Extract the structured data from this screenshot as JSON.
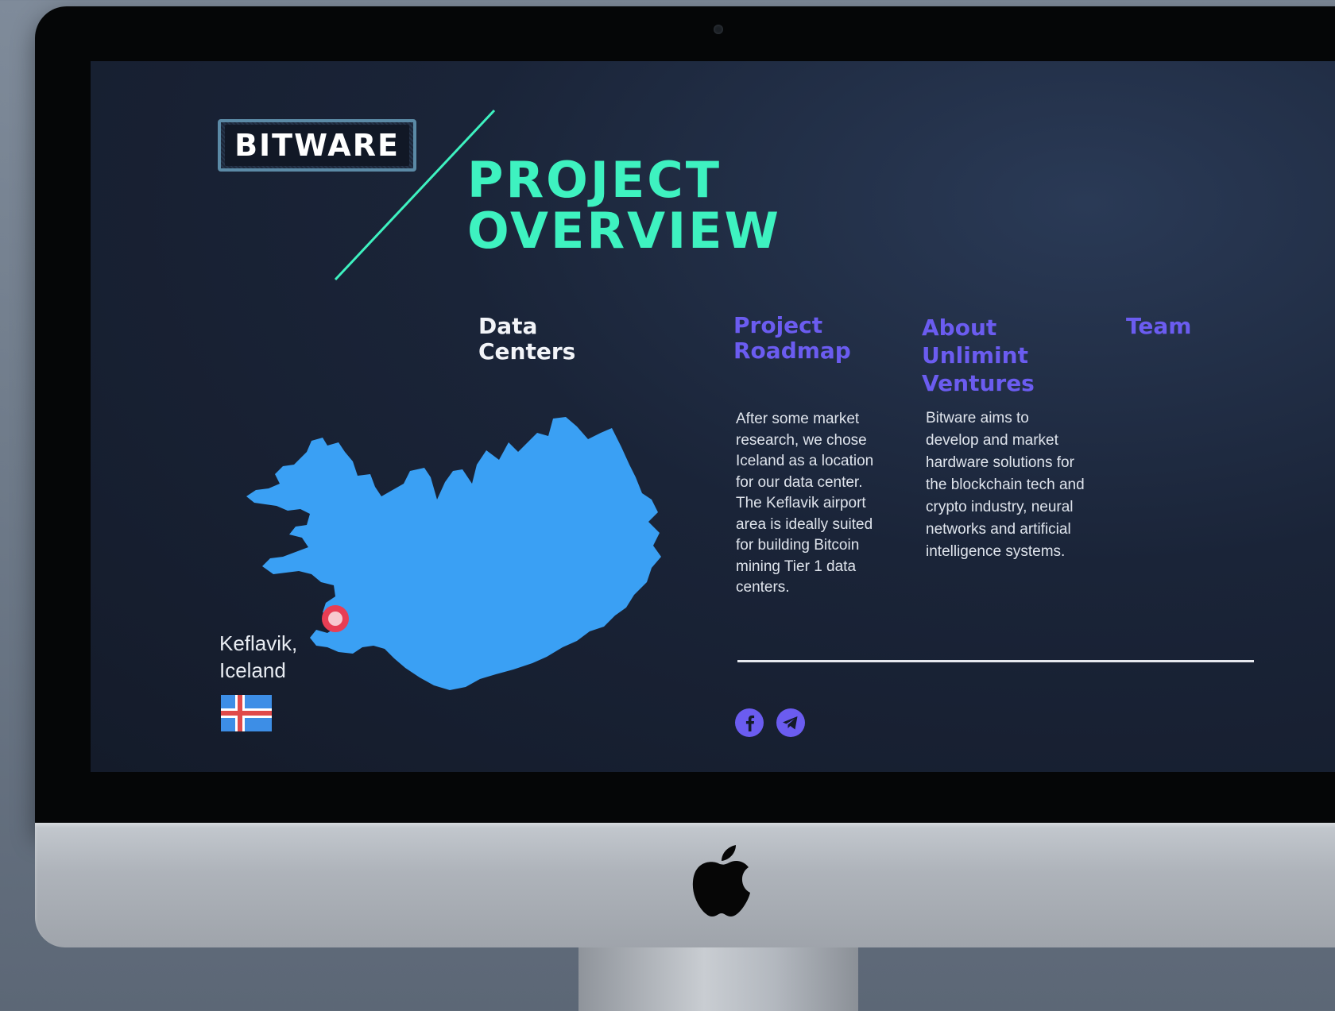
{
  "brand": {
    "logo_text": "BITWARE"
  },
  "hero": {
    "title_line1": "PROJECT",
    "title_line2": "OVERVIEW"
  },
  "nav": {
    "items": [
      {
        "line1": "Data",
        "line2": "Centers",
        "line3": "",
        "active": true
      },
      {
        "line1": "Project",
        "line2": "Roadmap",
        "line3": "",
        "active": false
      },
      {
        "line1": "About",
        "line2": "Unlimint",
        "line3": "Ventures",
        "active": false
      },
      {
        "line1": "Team",
        "line2": "",
        "line3": "",
        "active": false
      }
    ]
  },
  "location": {
    "line1": "Keflavik,",
    "line2": "Iceland"
  },
  "content": {
    "left_paragraph": [
      "After some market",
      "research, we chose",
      "Iceland as a location",
      "for our data center.",
      "The Keflavik airport",
      "area is ideally suited",
      "for building Bitcoin",
      "mining Tier 1 data",
      "centers."
    ],
    "right_paragraph": [
      "Bitware aims to",
      "develop and market",
      "hardware solutions for",
      "the blockchain tech and",
      "crypto industry, neural",
      "networks and artificial",
      "intelligence systems."
    ]
  },
  "social": {
    "icons": [
      "facebook-icon",
      "telegram-icon"
    ]
  },
  "colors": {
    "accent_teal": "#3ef2c0",
    "nav_link": "#6b5cf0",
    "map_blue": "#3aa0f4",
    "screen_bg": "#1a2438"
  }
}
